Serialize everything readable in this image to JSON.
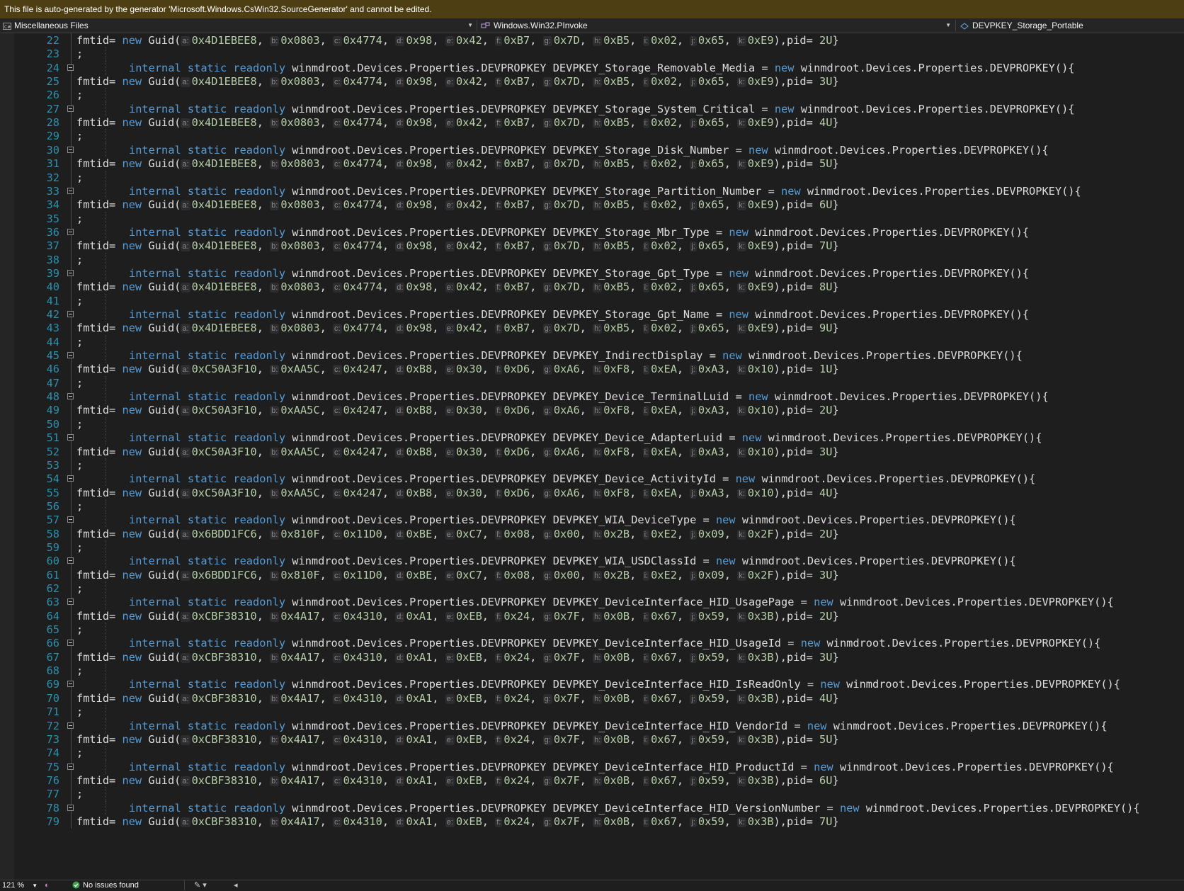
{
  "infobar": {
    "text": "This file is auto-generated by the generator 'Microsoft.Windows.CsWin32.SourceGenerator' and cannot be edited."
  },
  "navbar": {
    "project": "Miscellaneous Files",
    "type": "Windows.Win32.PInvoke",
    "member": "DEVPKEY_Storage_Portable"
  },
  "syntax": {
    "kw_internal": "internal",
    "kw_static": "static",
    "kw_readonly": "readonly",
    "kw_new": "new",
    "type_name": "winmdroot.Devices.Properties.DEVPROPKEY",
    "ctor_tail": "(){",
    "fmtid": "fmtid=",
    "guid": "Guid(",
    "pid": "),pid=",
    "close": "}",
    "semicolon": ";",
    "eq": "=",
    "comma": ","
  },
  "hint_labels": [
    "a:",
    "b:",
    "c:",
    "d:",
    "e:",
    "f:",
    "g:",
    "h:",
    "i:",
    "j:",
    "k:"
  ],
  "blocks": [
    {
      "line": 24,
      "name": "DEVPKEY_Storage_Removable_Media",
      "guid": [
        "0x4D1EBEE8",
        "0x0803",
        "0x4774",
        "0x98",
        "0x42",
        "0xB7",
        "0x7D",
        "0xB5",
        "0x02",
        "0x65",
        "0xE9"
      ],
      "pid": "3U"
    },
    {
      "line": 27,
      "name": "DEVPKEY_Storage_System_Critical",
      "guid": [
        "0x4D1EBEE8",
        "0x0803",
        "0x4774",
        "0x98",
        "0x42",
        "0xB7",
        "0x7D",
        "0xB5",
        "0x02",
        "0x65",
        "0xE9"
      ],
      "pid": "4U"
    },
    {
      "line": 30,
      "name": "DEVPKEY_Storage_Disk_Number",
      "guid": [
        "0x4D1EBEE8",
        "0x0803",
        "0x4774",
        "0x98",
        "0x42",
        "0xB7",
        "0x7D",
        "0xB5",
        "0x02",
        "0x65",
        "0xE9"
      ],
      "pid": "5U"
    },
    {
      "line": 33,
      "name": "DEVPKEY_Storage_Partition_Number",
      "guid": [
        "0x4D1EBEE8",
        "0x0803",
        "0x4774",
        "0x98",
        "0x42",
        "0xB7",
        "0x7D",
        "0xB5",
        "0x02",
        "0x65",
        "0xE9"
      ],
      "pid": "6U"
    },
    {
      "line": 36,
      "name": "DEVPKEY_Storage_Mbr_Type",
      "guid": [
        "0x4D1EBEE8",
        "0x0803",
        "0x4774",
        "0x98",
        "0x42",
        "0xB7",
        "0x7D",
        "0xB5",
        "0x02",
        "0x65",
        "0xE9"
      ],
      "pid": "7U"
    },
    {
      "line": 39,
      "name": "DEVPKEY_Storage_Gpt_Type",
      "guid": [
        "0x4D1EBEE8",
        "0x0803",
        "0x4774",
        "0x98",
        "0x42",
        "0xB7",
        "0x7D",
        "0xB5",
        "0x02",
        "0x65",
        "0xE9"
      ],
      "pid": "8U"
    },
    {
      "line": 42,
      "name": "DEVPKEY_Storage_Gpt_Name",
      "guid": [
        "0x4D1EBEE8",
        "0x0803",
        "0x4774",
        "0x98",
        "0x42",
        "0xB7",
        "0x7D",
        "0xB5",
        "0x02",
        "0x65",
        "0xE9"
      ],
      "pid": "9U"
    },
    {
      "line": 45,
      "name": "DEVPKEY_IndirectDisplay",
      "guid": [
        "0xC50A3F10",
        "0xAA5C",
        "0x4247",
        "0xB8",
        "0x30",
        "0xD6",
        "0xA6",
        "0xF8",
        "0xEA",
        "0xA3",
        "0x10"
      ],
      "pid": "1U"
    },
    {
      "line": 48,
      "name": "DEVPKEY_Device_TerminalLuid",
      "guid": [
        "0xC50A3F10",
        "0xAA5C",
        "0x4247",
        "0xB8",
        "0x30",
        "0xD6",
        "0xA6",
        "0xF8",
        "0xEA",
        "0xA3",
        "0x10"
      ],
      "pid": "2U"
    },
    {
      "line": 51,
      "name": "DEVPKEY_Device_AdapterLuid",
      "guid": [
        "0xC50A3F10",
        "0xAA5C",
        "0x4247",
        "0xB8",
        "0x30",
        "0xD6",
        "0xA6",
        "0xF8",
        "0xEA",
        "0xA3",
        "0x10"
      ],
      "pid": "3U"
    },
    {
      "line": 54,
      "name": "DEVPKEY_Device_ActivityId",
      "guid": [
        "0xC50A3F10",
        "0xAA5C",
        "0x4247",
        "0xB8",
        "0x30",
        "0xD6",
        "0xA6",
        "0xF8",
        "0xEA",
        "0xA3",
        "0x10"
      ],
      "pid": "4U"
    },
    {
      "line": 57,
      "name": "DEVPKEY_WIA_DeviceType",
      "guid": [
        "0x6BDD1FC6",
        "0x810F",
        "0x11D0",
        "0xBE",
        "0xC7",
        "0x08",
        "0x00",
        "0x2B",
        "0xE2",
        "0x09",
        "0x2F"
      ],
      "pid": "2U"
    },
    {
      "line": 60,
      "name": "DEVPKEY_WIA_USDClassId",
      "guid": [
        "0x6BDD1FC6",
        "0x810F",
        "0x11D0",
        "0xBE",
        "0xC7",
        "0x08",
        "0x00",
        "0x2B",
        "0xE2",
        "0x09",
        "0x2F"
      ],
      "pid": "3U"
    },
    {
      "line": 63,
      "name": "DEVPKEY_DeviceInterface_HID_UsagePage",
      "guid": [
        "0xCBF38310",
        "0x4A17",
        "0x4310",
        "0xA1",
        "0xEB",
        "0x24",
        "0x7F",
        "0x0B",
        "0x67",
        "0x59",
        "0x3B"
      ],
      "pid": "2U"
    },
    {
      "line": 66,
      "name": "DEVPKEY_DeviceInterface_HID_UsageId",
      "guid": [
        "0xCBF38310",
        "0x4A17",
        "0x4310",
        "0xA1",
        "0xEB",
        "0x24",
        "0x7F",
        "0x0B",
        "0x67",
        "0x59",
        "0x3B"
      ],
      "pid": "3U"
    },
    {
      "line": 69,
      "name": "DEVPKEY_DeviceInterface_HID_IsReadOnly",
      "guid": [
        "0xCBF38310",
        "0x4A17",
        "0x4310",
        "0xA1",
        "0xEB",
        "0x24",
        "0x7F",
        "0x0B",
        "0x67",
        "0x59",
        "0x3B"
      ],
      "pid": "4U"
    },
    {
      "line": 72,
      "name": "DEVPKEY_DeviceInterface_HID_VendorId",
      "guid": [
        "0xCBF38310",
        "0x4A17",
        "0x4310",
        "0xA1",
        "0xEB",
        "0x24",
        "0x7F",
        "0x0B",
        "0x67",
        "0x59",
        "0x3B"
      ],
      "pid": "5U"
    },
    {
      "line": 75,
      "name": "DEVPKEY_DeviceInterface_HID_ProductId",
      "guid": [
        "0xCBF38310",
        "0x4A17",
        "0x4310",
        "0xA1",
        "0xEB",
        "0x24",
        "0x7F",
        "0x0B",
        "0x67",
        "0x59",
        "0x3B"
      ],
      "pid": "6U"
    },
    {
      "line": 78,
      "name": "DEVPKEY_DeviceInterface_HID_VersionNumber",
      "guid": [
        "0xCBF38310",
        "0x4A17",
        "0x4310",
        "0xA1",
        "0xEB",
        "0x24",
        "0x7F",
        "0x0B",
        "0x67",
        "0x59",
        "0x3B"
      ],
      "pid": "7U"
    }
  ],
  "first_lines": {
    "line22": {
      "number": 22,
      "guid": [
        "0x4D1EBEE8",
        "0x0803",
        "0x4774",
        "0x98",
        "0x42",
        "0xB7",
        "0x7D",
        "0xB5",
        "0x02",
        "0x65",
        "0xE9"
      ],
      "pid": "2U"
    },
    "line23": {
      "number": 23
    }
  },
  "status": {
    "zoom": "121 %",
    "issues": "No issues found"
  },
  "colors": {
    "keyword": "#569cd6",
    "number": "#b5cea8",
    "line_number": "#2b91af",
    "infobar_bg": "#4d3f13",
    "editor_bg": "#1e1e1e"
  }
}
